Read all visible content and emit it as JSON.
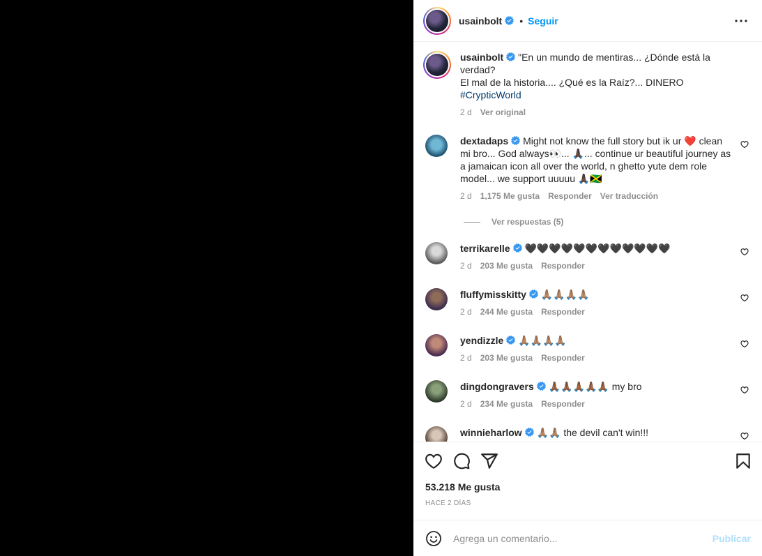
{
  "post": {
    "author": "usainbolt",
    "follow_label": "Seguir",
    "dot": "•"
  },
  "caption": {
    "username": "usainbolt",
    "text": "\"En un mundo de mentiras... ¿Dónde está la verdad?\nEl mal de la historia.... ¿Qué es la Raíz?... DINERO",
    "hashtag": "#CrypticWorld",
    "time": "2 d",
    "see_original": "Ver original"
  },
  "comments": [
    {
      "username": "dextadaps",
      "text": "Might not know the full story but ik ur ❤️ clean mi bro... God always👀... 🙏🏿... continue ur beautiful journey as a jamaican icon all over the world, n ghetto yute dem role model... we support uuuuu 🙏🏿🇯🇲",
      "time": "2 d",
      "likes": "1,175 Me gusta",
      "reply": "Responder",
      "translate": "Ver traducción",
      "view_replies": "Ver respuestas (5)"
    },
    {
      "username": "terrikarelle",
      "text": "🖤🖤🖤🖤🖤🖤🖤🖤🖤🖤🖤🖤",
      "time": "2 d",
      "likes": "203 Me gusta",
      "reply": "Responder"
    },
    {
      "username": "fluffymisskitty",
      "text": "🙏🏽🙏🏽🙏🏽🙏🏽",
      "time": "2 d",
      "likes": "244 Me gusta",
      "reply": "Responder"
    },
    {
      "username": "yendizzle",
      "text": "🙏🏽🙏🏽🙏🏽🙏🏽",
      "time": "2 d",
      "likes": "203 Me gusta",
      "reply": "Responder"
    },
    {
      "username": "dingdongravers",
      "text": "🙏🏾🙏🏾🙏🏾🙏🏾🙏🏾 my bro",
      "time": "2 d",
      "likes": "234 Me gusta",
      "reply": "Responder"
    },
    {
      "username": "winnieharlow",
      "text": "🙏🏽🙏🏽 the devil can't win!!!"
    }
  ],
  "stats": {
    "likes": "53.218 Me gusta",
    "time_ago": "Hace 2 días"
  },
  "comment_box": {
    "placeholder": "Agrega un comentario...",
    "publish": "Publicar"
  },
  "colors": {
    "accent": "#0095f6",
    "verified": "#3897f0",
    "publish_disabled": "#b2dffc",
    "secondary_text": "#8e8e8e"
  }
}
